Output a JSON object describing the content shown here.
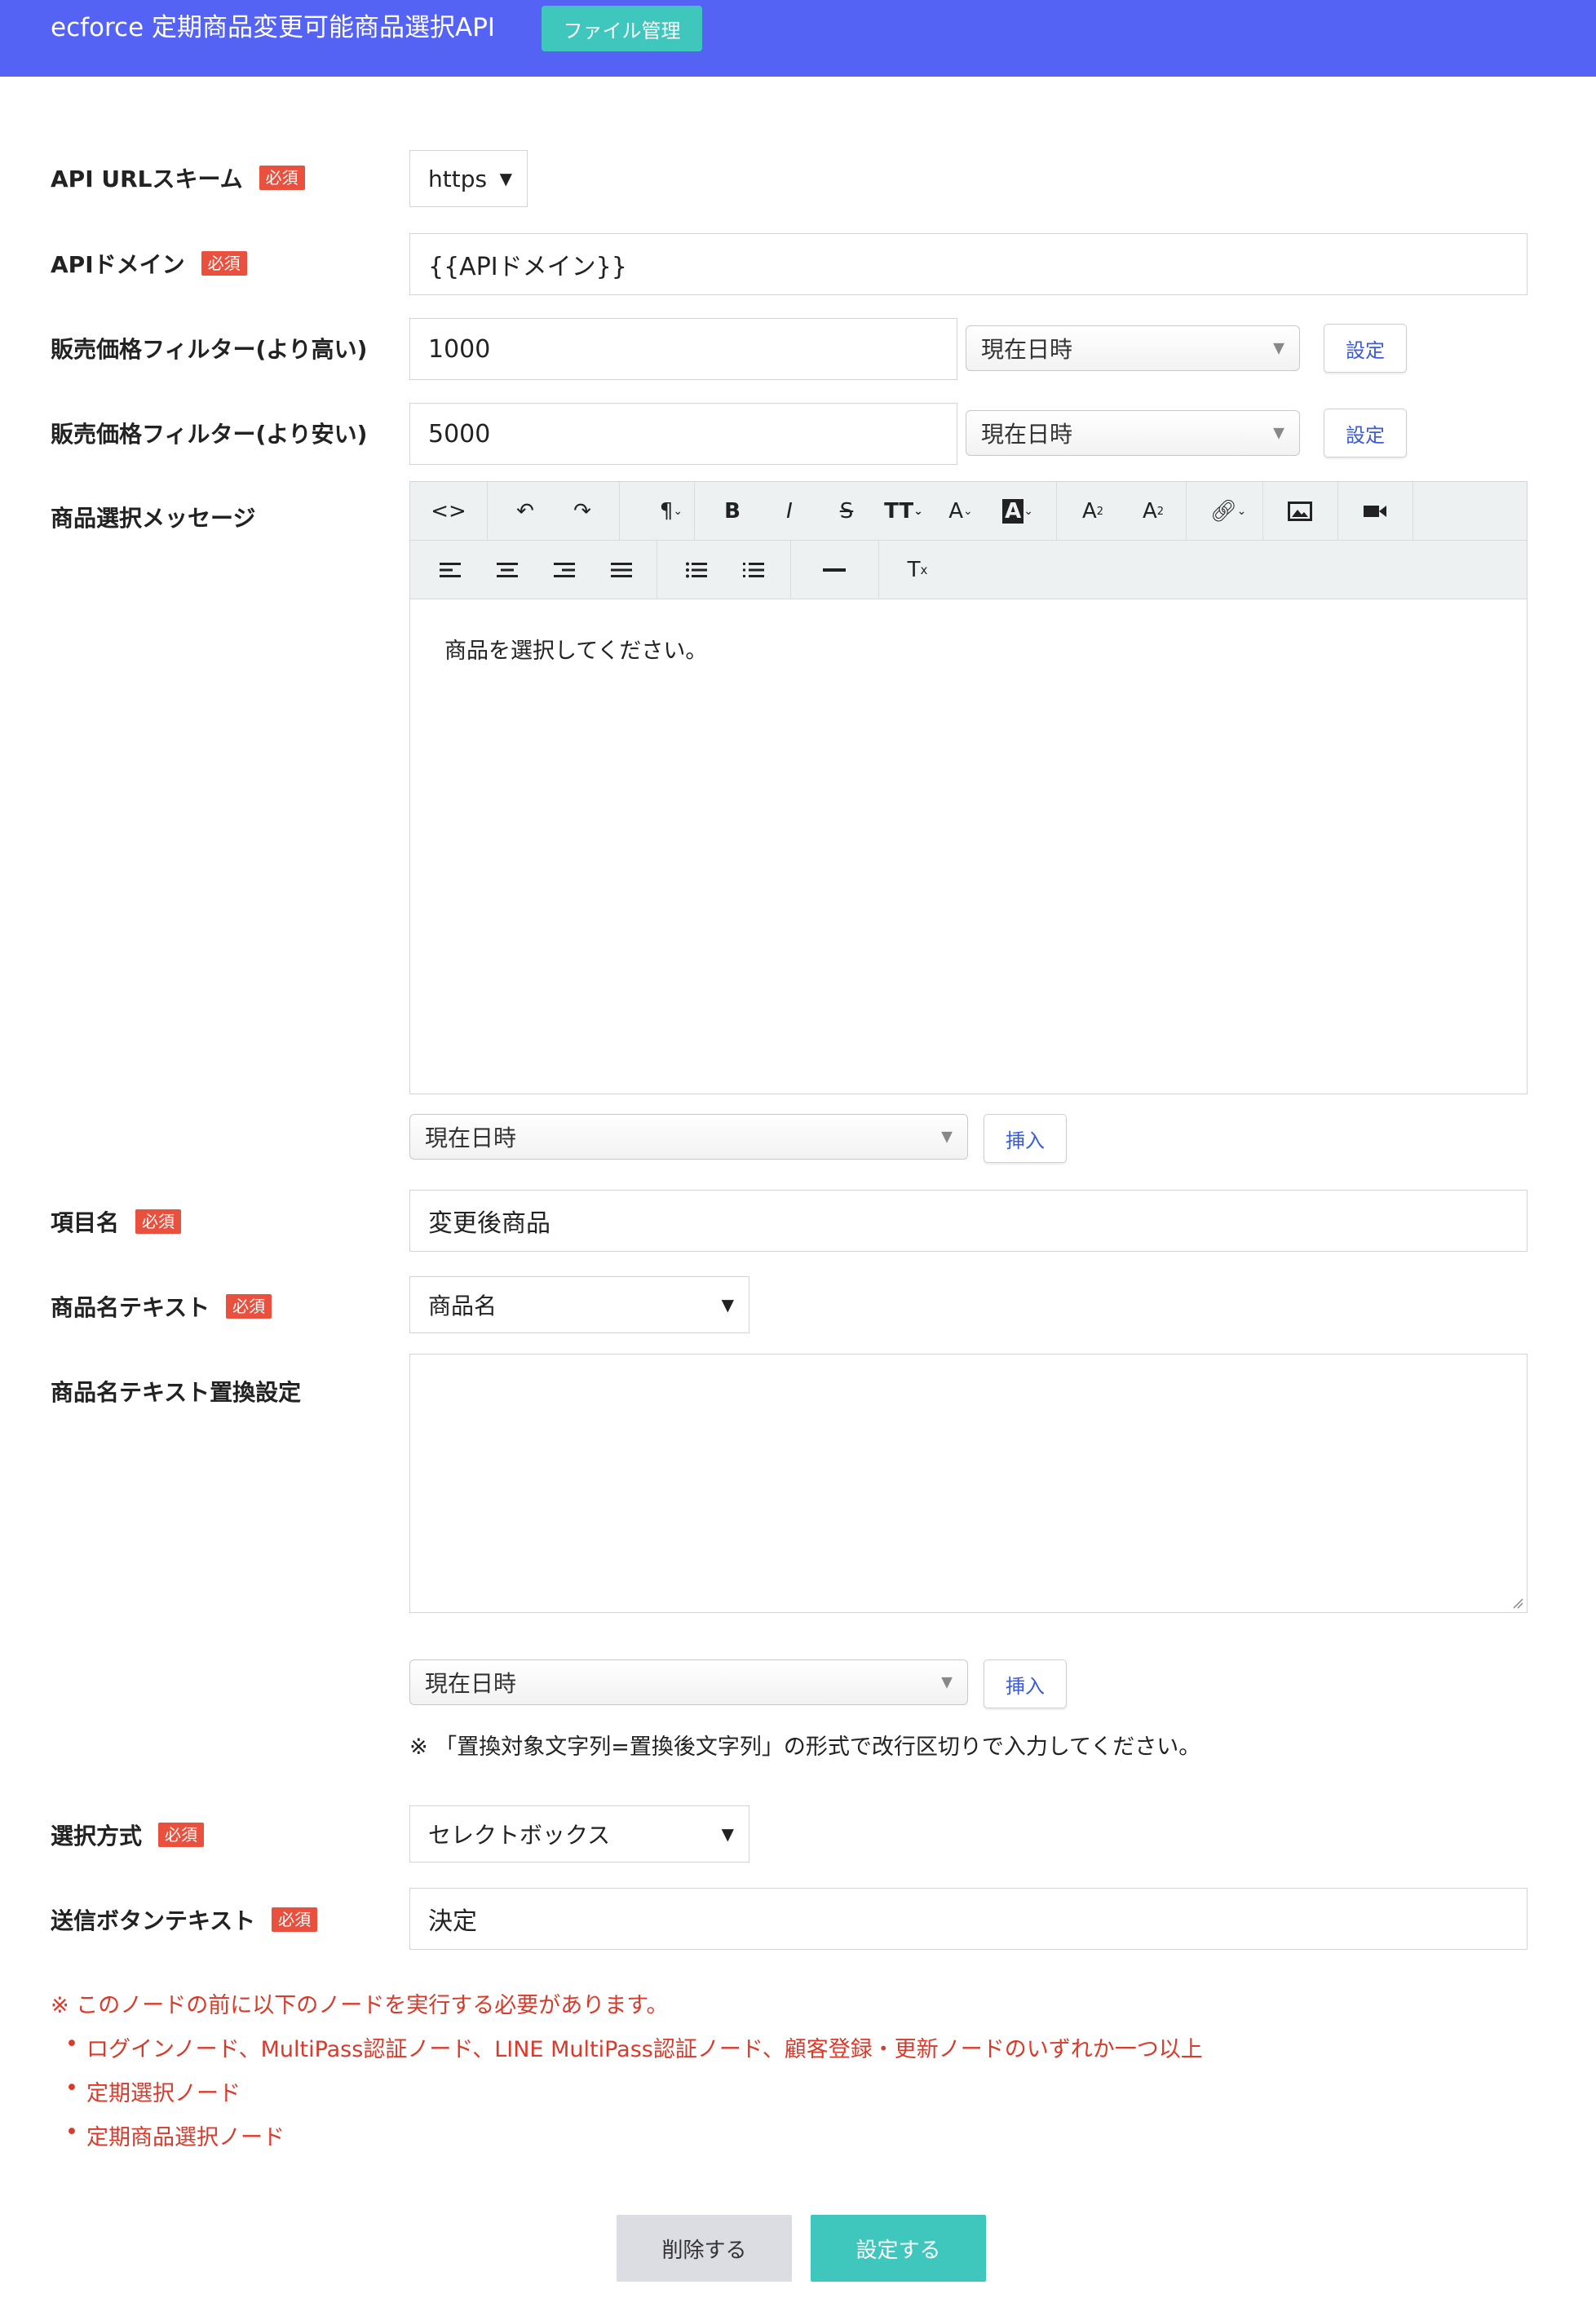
{
  "header": {
    "title": "ecforce 定期商品変更可能商品選択API",
    "file_button": "ファイル管理"
  },
  "required_badge": "必須",
  "fields": {
    "scheme": {
      "label": "API URLスキーム",
      "value": "https"
    },
    "domain": {
      "label": "APIドメイン",
      "value": "{{APIドメイン}}"
    },
    "price_high": {
      "label": "販売価格フィルター(より高い)",
      "value": "1000",
      "date_select": "現在日時",
      "button": "設定"
    },
    "price_low": {
      "label": "販売価格フィルター(より安い)",
      "value": "5000",
      "date_select": "現在日時",
      "button": "設定"
    },
    "message": {
      "label": "商品選択メッセージ",
      "body": "商品を選択してください。",
      "date_select": "現在日時",
      "button": "挿入"
    },
    "item_name": {
      "label": "項目名",
      "value": "変更後商品"
    },
    "product_text": {
      "label": "商品名テキスト",
      "value": "商品名"
    },
    "replace": {
      "label": "商品名テキスト置換設定",
      "value": "",
      "date_select": "現在日時",
      "button": "挿入",
      "note": "※ 「置換対象文字列=置換後文字列」の形式で改行区切りで入力してください。"
    },
    "select_mode": {
      "label": "選択方式",
      "value": "セレクトボックス"
    },
    "submit_text": {
      "label": "送信ボタンテキスト",
      "value": "決定"
    }
  },
  "toolbar": {
    "row1": [
      "code",
      "undo",
      "redo",
      "paragraph",
      "bold",
      "italic",
      "strikethrough",
      "font-size",
      "font-color",
      "highlight",
      "superscript",
      "subscript",
      "link",
      "image",
      "video"
    ],
    "row2": [
      "align-left",
      "align-center",
      "align-right",
      "align-justify",
      "bullet-list",
      "numbered-list",
      "horizontal-rule",
      "clear-format"
    ]
  },
  "warning": {
    "intro": "※ このノードの前に以下のノードを実行する必要があります。",
    "items": [
      "ログインノード、MultiPass認証ノード、LINE MultiPass認証ノード、顧客登録・更新ノードのいずれか一つ以上",
      "定期選択ノード",
      "定期商品選択ノード"
    ]
  },
  "actions": {
    "delete": "削除する",
    "save": "設定する"
  },
  "colors": {
    "header": "#5563f5",
    "accent": "#3fc6bd",
    "required": "#e9503e",
    "warning": "#d83b2b",
    "link_blue": "#3b5bdb"
  }
}
